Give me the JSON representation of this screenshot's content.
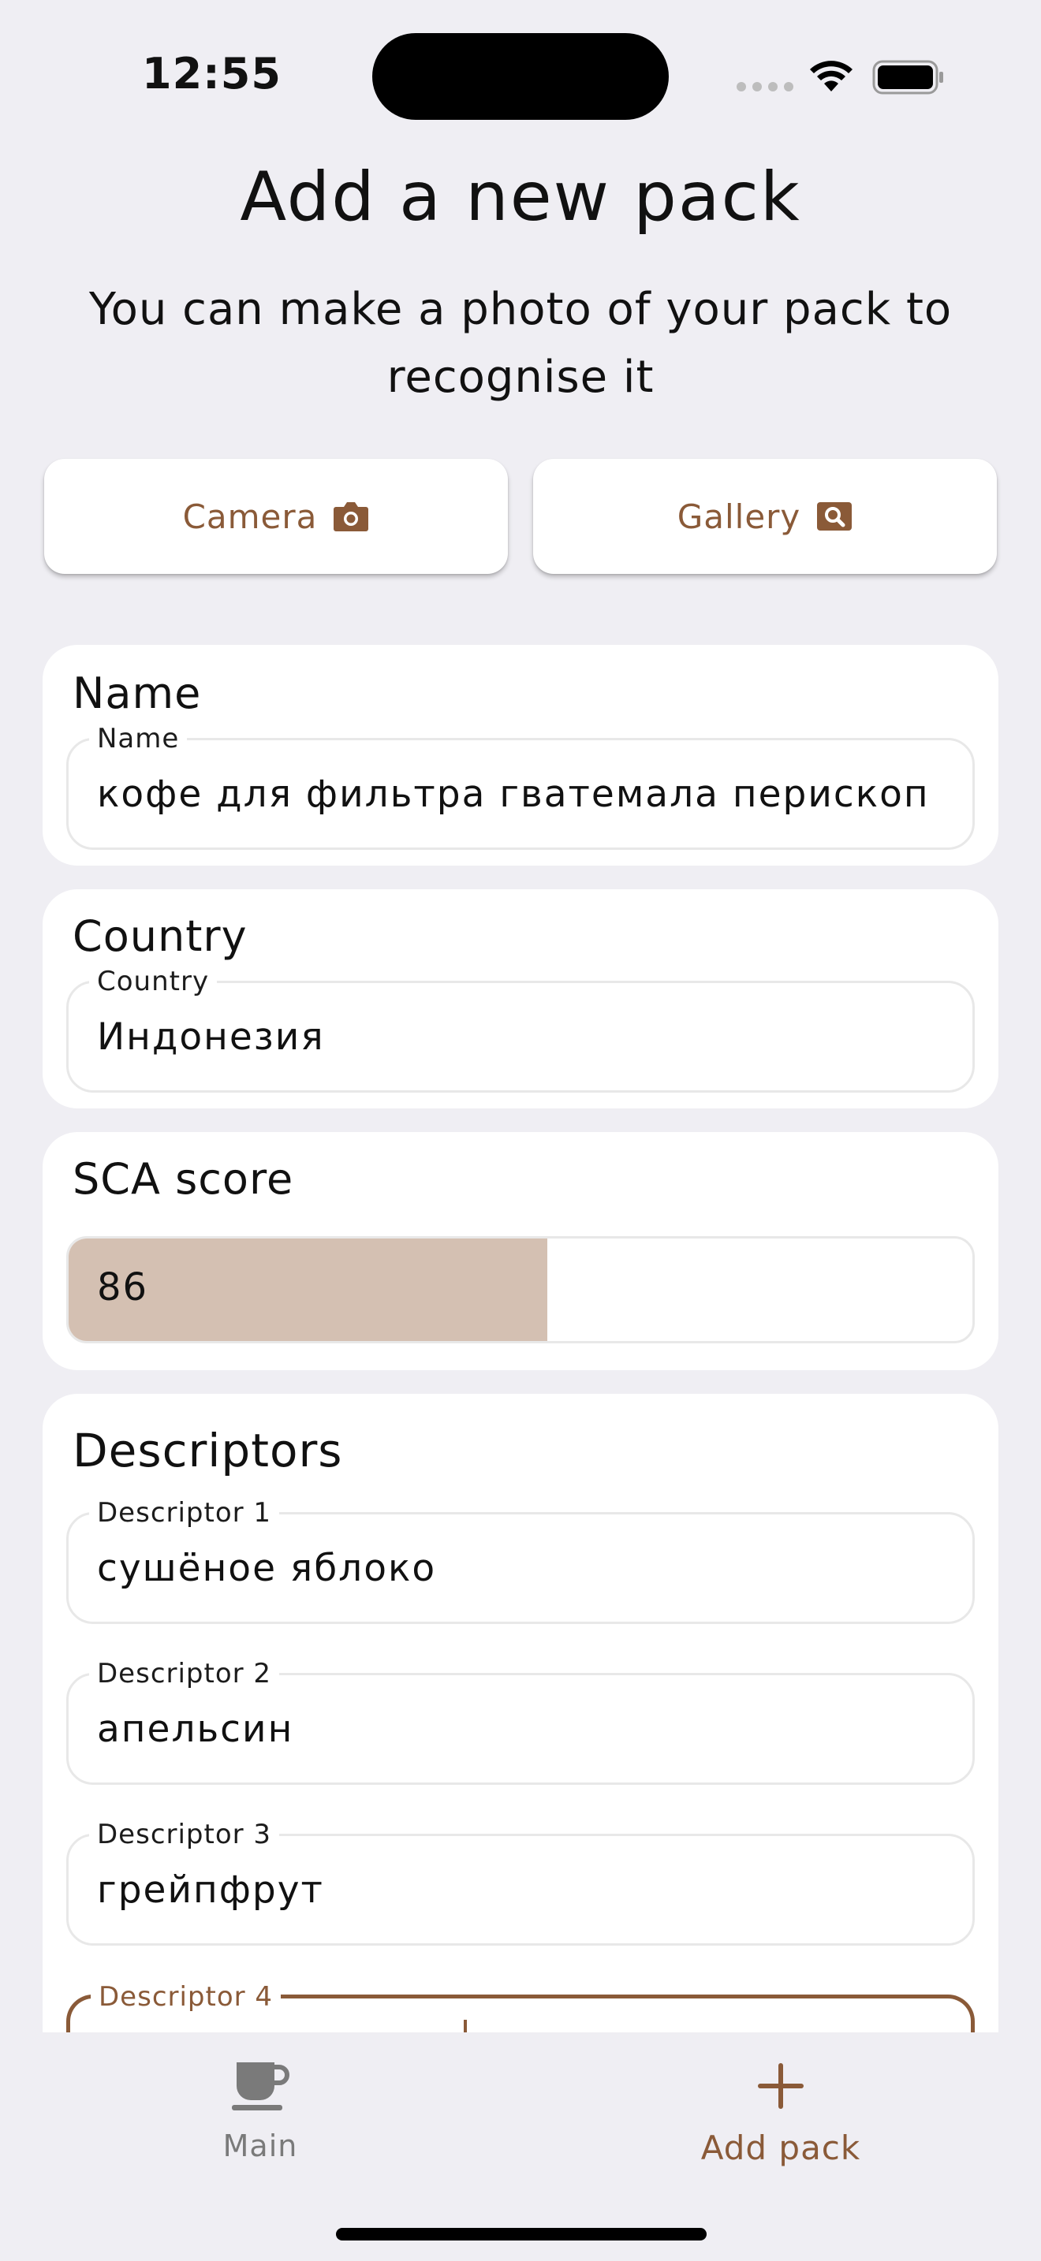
{
  "status_bar": {
    "time": "12:55"
  },
  "header": {
    "title": "Add a new pack",
    "subtitle": "You can make a photo of your pack to recognise it"
  },
  "photo_buttons": {
    "camera_label": "Camera",
    "camera_icon": "camera-icon",
    "gallery_label": "Gallery",
    "gallery_icon": "image-search-icon"
  },
  "name_card": {
    "title": "Name",
    "field_label": "Name",
    "field_value": "кофе для фильтра гватемала перископ рау..."
  },
  "country_card": {
    "title": "Country",
    "field_label": "Country",
    "field_value": "Индонезия"
  },
  "score_card": {
    "title": "SCA score",
    "value": "86",
    "fill_fraction": 0.53
  },
  "descriptors_card": {
    "title": "Descriptors",
    "fields": [
      {
        "label": "Descriptor 1",
        "value": "сушёное яблоко"
      },
      {
        "label": "Descriptor 2",
        "value": "апельсин"
      },
      {
        "label": "Descriptor 3",
        "value": "грейпфрут"
      },
      {
        "label": "Descriptor 4",
        "value": ""
      }
    ]
  },
  "tab_bar": {
    "items": [
      {
        "label": "Main",
        "icon": "coffee-cup-icon",
        "active": false
      },
      {
        "label": "Add pack",
        "icon": "plus-icon",
        "active": true
      }
    ]
  },
  "colors": {
    "accent": "#8a5a38",
    "background": "#efeef3",
    "card": "#ffffff",
    "score_fill": "#d4c0b2",
    "inactive_tab": "#7a7a7a"
  }
}
